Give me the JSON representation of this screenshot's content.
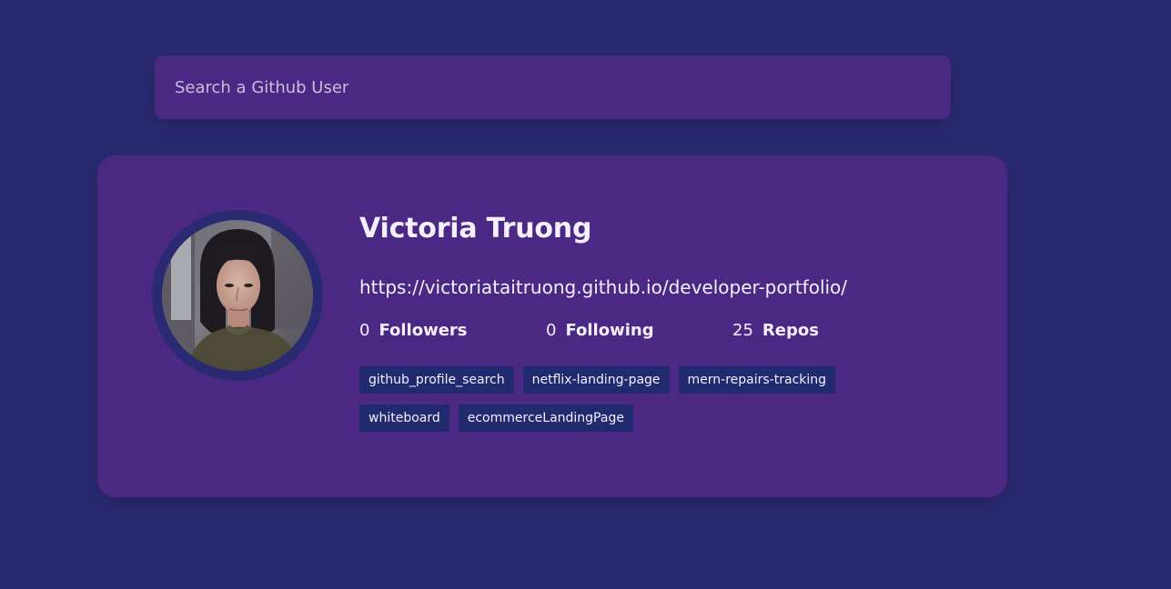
{
  "search": {
    "placeholder": "Search a Github User"
  },
  "profile": {
    "name": "Victoria Truong",
    "url": "https://victoriataitruong.github.io/developer-portfolio/",
    "followers": {
      "value": "0",
      "label": "Followers"
    },
    "following": {
      "value": "0",
      "label": "Following"
    },
    "repos": {
      "value": "25",
      "label": "Repos"
    },
    "avatar_icon": "profile-photo"
  },
  "repositories": [
    "github_profile_search",
    "netflix-landing-page",
    "mern-repairs-tracking",
    "whiteboard",
    "ecommerceLandingPage"
  ],
  "colors": {
    "background": "#2a2a72",
    "card": "#4c2885",
    "tag": "#212a6e",
    "text": "#f3f0ff"
  }
}
